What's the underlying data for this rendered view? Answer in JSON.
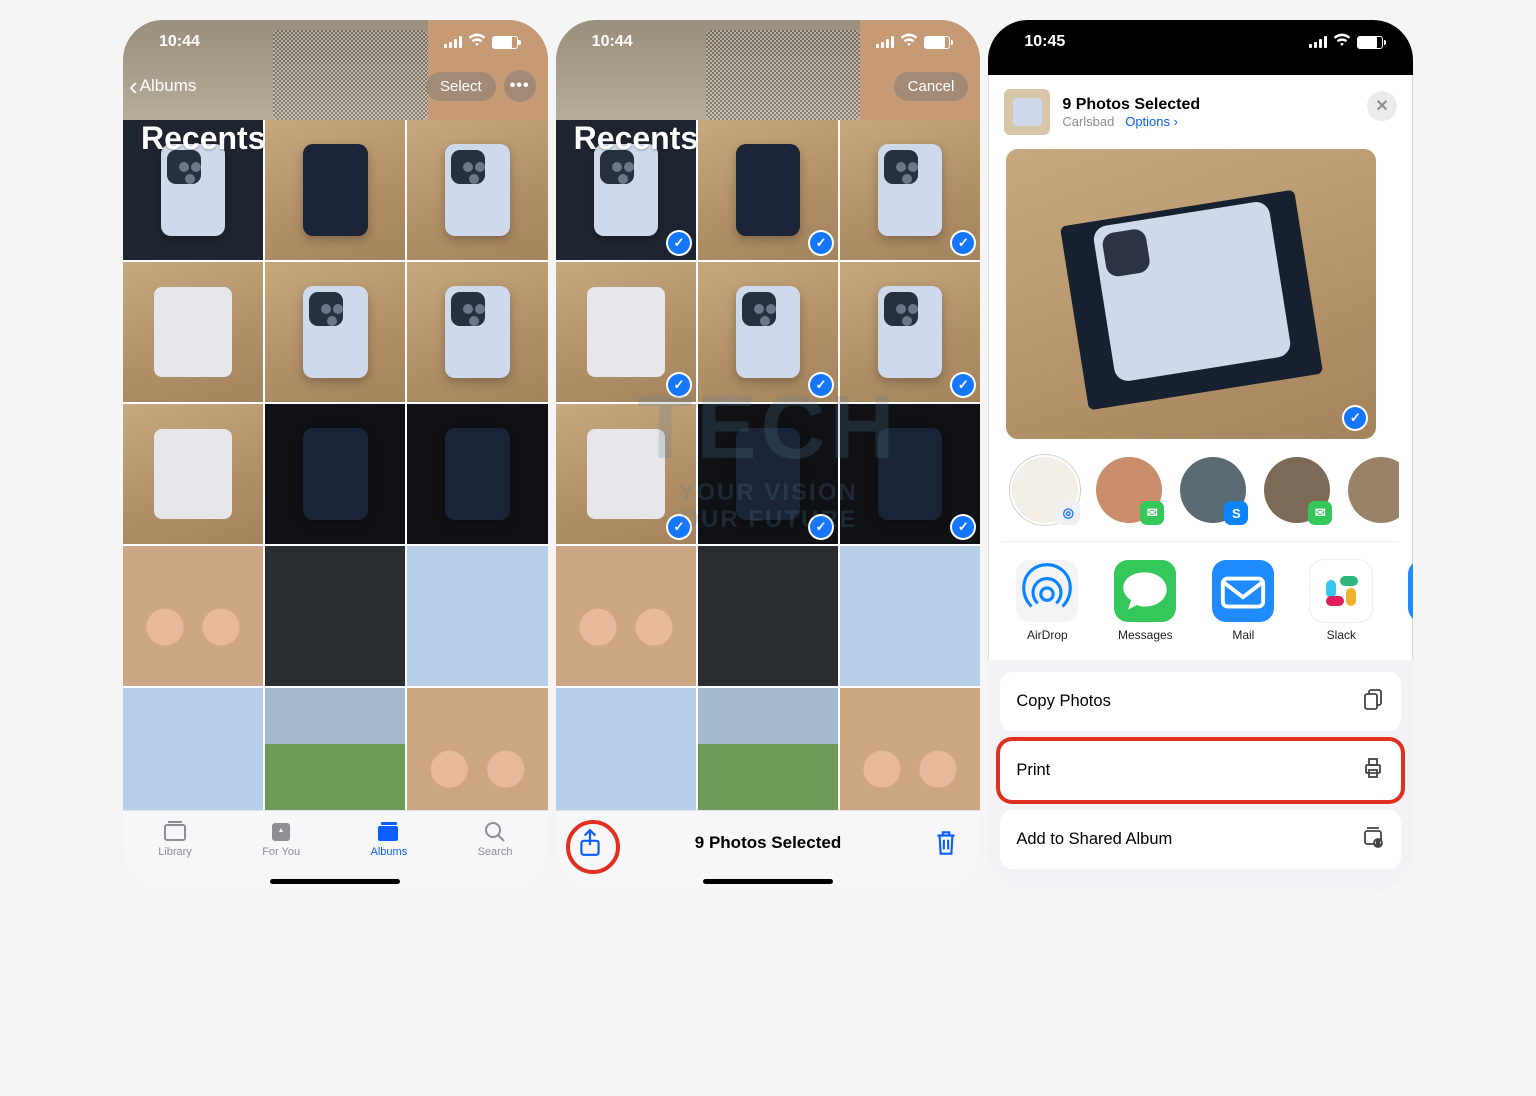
{
  "status": {
    "time1": "10:44",
    "time2": "10:44",
    "time3": "10:45"
  },
  "screen1": {
    "back": "Albums",
    "title": "Recents",
    "select": "Select",
    "tabs": {
      "library": "Library",
      "foryou": "For You",
      "albums": "Albums",
      "search": "Search"
    }
  },
  "screen2": {
    "title": "Recents",
    "cancel": "Cancel",
    "selected_label": "9 Photos Selected"
  },
  "screen3": {
    "header_title": "9 Photos Selected",
    "header_sub": "Carlsbad",
    "options": "Options",
    "apps": {
      "airdrop": "AirDrop",
      "messages": "Messages",
      "mail": "Mail",
      "slack": "Slack"
    },
    "actions": {
      "copy": "Copy Photos",
      "print": "Print",
      "shared": "Add to Shared Album"
    }
  },
  "watermark": {
    "big": "TECH",
    "l1": "YOUR VISION",
    "l2": "OUR FUTURE"
  }
}
